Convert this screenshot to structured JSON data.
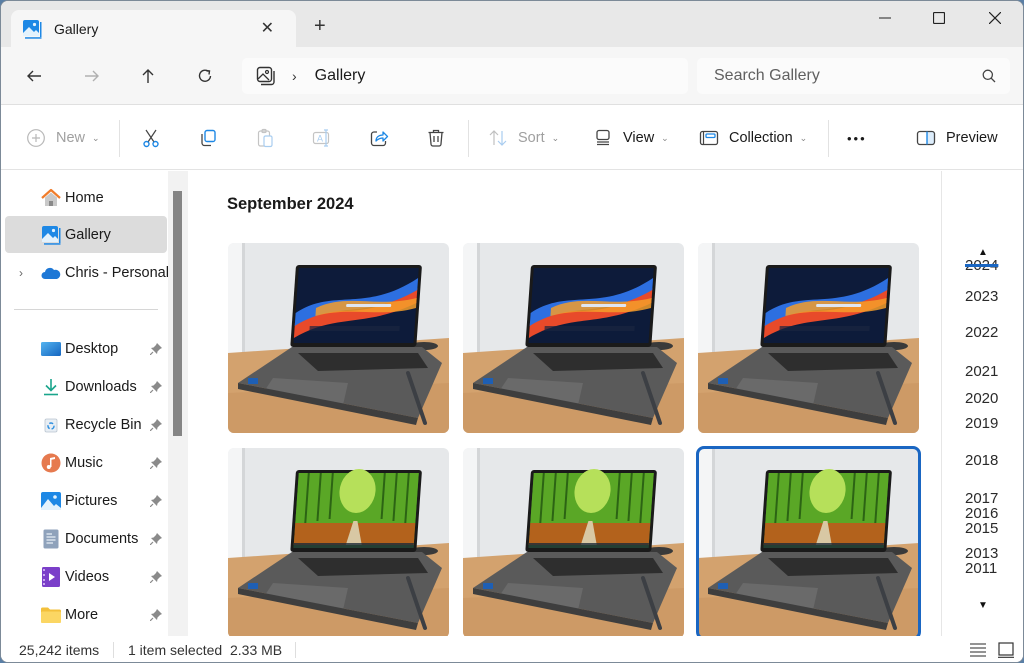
{
  "window": {
    "tab_title": "Gallery",
    "tab_icon": "gallery-icon",
    "new_tab_label": "+",
    "controls": [
      "minimize-icon",
      "maximize-icon",
      "close-icon"
    ]
  },
  "navigation": {
    "back": "arrow-left-icon",
    "forward": "arrow-right-icon",
    "up": "arrow-up-icon",
    "refresh": "refresh-icon",
    "breadcrumb": [
      {
        "icon": "gallery-icon"
      },
      {
        "label": "Gallery"
      }
    ],
    "breadcrumb_separator": "›",
    "search_placeholder": "Search Gallery"
  },
  "toolbar": {
    "new_label": "New",
    "cut": "cut-icon",
    "copy": "copy-icon",
    "paste": "paste-icon",
    "rename": "rename-icon",
    "share": "share-icon",
    "delete": "delete-icon",
    "sort_label": "Sort",
    "view_label": "View",
    "collection_label": "Collection",
    "more_label": "•••",
    "preview_label": "Preview"
  },
  "sidebar": {
    "top_items": [
      {
        "label": "Home",
        "icon": "home-icon"
      },
      {
        "label": "Gallery",
        "icon": "gallery-icon",
        "selected": true
      },
      {
        "label": "Chris - Personal",
        "icon": "onedrive-cloud-icon",
        "expandable": true
      }
    ],
    "pinned_items": [
      {
        "label": "Desktop",
        "icon": "desktop-icon"
      },
      {
        "label": "Downloads",
        "icon": "download-icon"
      },
      {
        "label": "Recycle Bin",
        "icon": "recycle-bin-icon"
      },
      {
        "label": "Music",
        "icon": "music-icon"
      },
      {
        "label": "Pictures",
        "icon": "pictures-icon"
      },
      {
        "label": "Documents",
        "icon": "documents-icon"
      },
      {
        "label": "Videos",
        "icon": "videos-icon"
      },
      {
        "label": "More",
        "icon": "folder-icon"
      }
    ]
  },
  "content": {
    "group_title": "September 2024",
    "photos": [
      {
        "subject": "laptop with colorful wave wallpaper",
        "screen": "wave",
        "selected": false
      },
      {
        "subject": "laptop with colorful wave wallpaper",
        "screen": "wave",
        "selected": false
      },
      {
        "subject": "laptop with colorful wave wallpaper",
        "screen": "wave",
        "selected": false
      },
      {
        "subject": "laptop with bamboo forest wallpaper",
        "screen": "bamboo",
        "selected": false
      },
      {
        "subject": "laptop with bamboo forest wallpaper",
        "screen": "bamboo",
        "selected": false
      },
      {
        "subject": "laptop with bamboo forest wallpaper",
        "screen": "bamboo",
        "selected": true
      }
    ]
  },
  "timeline": {
    "current_year": "2024",
    "years": [
      "2024",
      "2023",
      "2022",
      "2021",
      "2020",
      "2019",
      "2018",
      "2017",
      "2016",
      "2015",
      "2013",
      "2011"
    ]
  },
  "status": {
    "item_count": "25,242 items",
    "selection": "1 item selected",
    "size": "2.33 MB"
  },
  "colors": {
    "accent": "#1a66c2",
    "selected_nav": "#dcdcdc"
  }
}
